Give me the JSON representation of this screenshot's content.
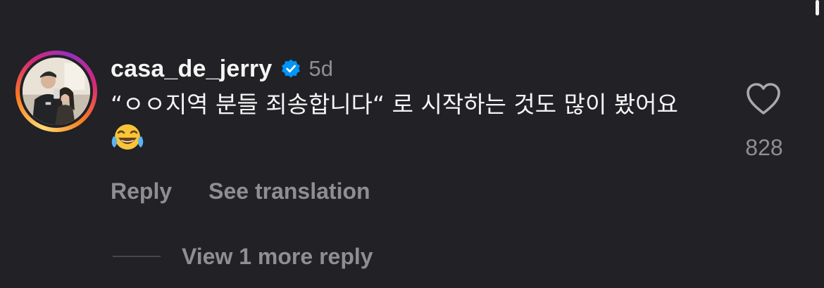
{
  "comment": {
    "username": "casa_de_jerry",
    "time": "5d",
    "text": "“ㅇㅇ지역 분들 죄송합니다“ 로 시작하는 것도 많이 봤어요",
    "like_count": "828"
  },
  "actions": {
    "reply_label": "Reply",
    "translate_label": "See translation"
  },
  "replies": {
    "view_more_label": "View 1 more reply"
  },
  "icons": {
    "verified": "verified-badge-icon",
    "like": "heart-outline-icon",
    "emoji": "face-with-tears-of-joy"
  },
  "colors": {
    "background": "#212126",
    "primary_text": "#f5f5f5",
    "secondary_text": "#8e8e93",
    "verified_blue": "#0095f6"
  }
}
